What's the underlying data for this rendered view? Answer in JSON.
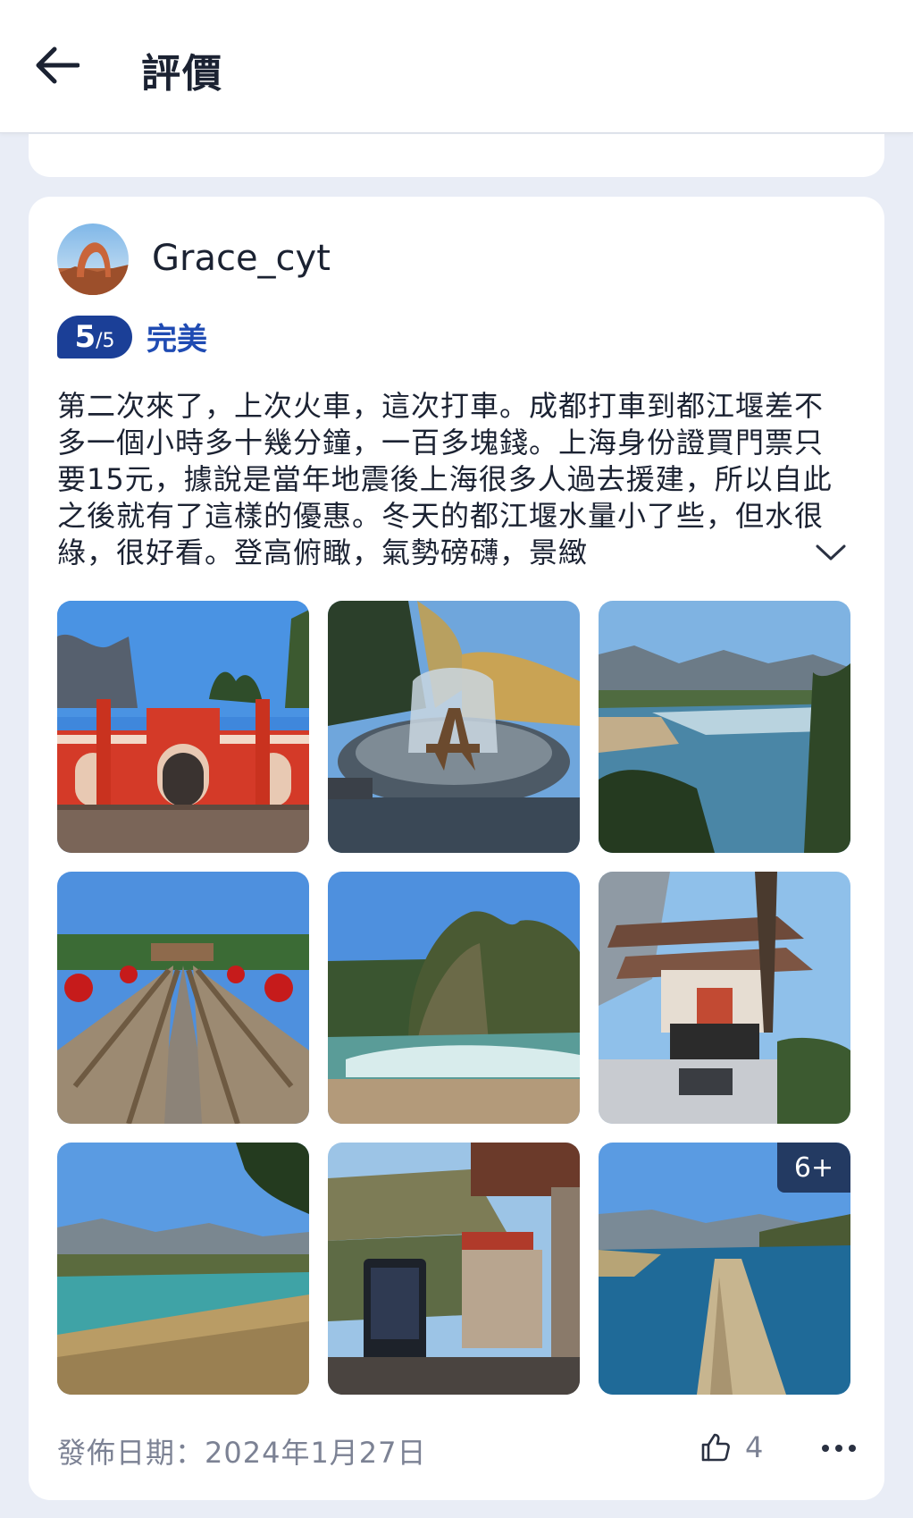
{
  "header": {
    "title": "評價",
    "back_icon": "arrow-left-icon"
  },
  "review": {
    "username": "Grace_cyt",
    "rating": {
      "score": "5",
      "max": "/5",
      "label": "完美"
    },
    "text": "第二次來了，上次火車，這次打車。成都打車到都江堰差不多一個小時多十幾分鐘，一百多塊錢。上海身份證買門票只要15元，據說是當年地震後上海很多人過去援建，所以自此之後就有了這樣的優惠。冬天的都江堰水量小了些，但水很綠，很好看。登高俯瞰，氣勢磅礴，景緻",
    "expand_icon": "chevron-down-icon",
    "photos": {
      "more_label": "6+"
    },
    "date": "發佈日期：2024年1月27日",
    "like_icon": "thumbs-up-icon",
    "likes": "4",
    "more_icon": "more-horizontal-icon"
  },
  "colors": {
    "accent": "#1b3f97",
    "label_blue": "#1f4bb3",
    "page_bg": "#e9edf6"
  }
}
